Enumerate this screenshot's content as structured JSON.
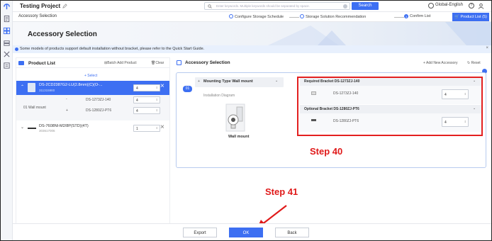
{
  "app": {
    "project_title": "Testing Project",
    "search_placeholder": "Enter keywords. Multiple keywords should be separated by space.",
    "search_button": "Search",
    "language": "Global-English"
  },
  "subheader": {
    "breadcrumb": "Accessory Selection",
    "steps": [
      "Configure Storage Schedule",
      "Storage Solution Recommendation",
      "Confirm List"
    ],
    "active_step_number": "3",
    "product_list_button": "Product List (5)"
  },
  "banner": {
    "title": "Accessory Selection"
  },
  "info_bar": {
    "text": "Some models of products support default installation without bracket, please refer to the Quick Start Guide."
  },
  "left_panel": {
    "title": "Product List",
    "batch_add": "Batch Add Product",
    "clear": "Clear",
    "select": "+ Select",
    "products": [
      {
        "name": "DS-2CD2387G2-LU(2.8mm)(C)(O-...",
        "code": "311315980",
        "qty": "4",
        "selected": true
      },
      {
        "name": "DS-7608NI-M2/8P(STD)(4T)",
        "code": "303617006",
        "qty": "1",
        "selected": false
      }
    ],
    "mount_group": {
      "label": "01 Wall mount",
      "items": [
        {
          "name": "DS-1273ZJ-140",
          "qty": "4"
        },
        {
          "name": "DS-1280ZJ-PT6",
          "qty": "4"
        }
      ]
    }
  },
  "right_panel": {
    "title": "Accessory Selection",
    "add_new": "+ Add New Accessory",
    "reset": "Reset",
    "mount": {
      "number": "01",
      "type_label": "Mounting Type Wall mount",
      "diagram_label": "Installation Diagram",
      "image_caption": "Wall mount"
    },
    "required": {
      "label": "Required Bracket DS-1273ZJ-140",
      "item": "DS-1273ZJ-140",
      "qty": "4"
    },
    "optional": {
      "label": "Optional Bracket DS-1280ZJ-PT6",
      "item": "DS-1280ZJ-PT6",
      "qty": "4"
    }
  },
  "footer": {
    "export": "Export",
    "ok": "OK",
    "back": "Back"
  },
  "annotations": {
    "step40": "Step 40",
    "step41": "Step 41"
  },
  "colors": {
    "accent": "#3d6ff2",
    "annotation": "#e01a1a",
    "selected_row": "#3d6ff2"
  }
}
